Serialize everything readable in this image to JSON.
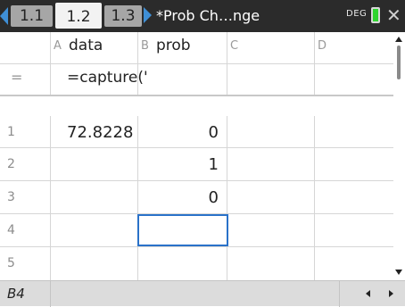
{
  "topbar": {
    "tabs": [
      {
        "label": "1.1",
        "active": false
      },
      {
        "label": "1.2",
        "active": true
      },
      {
        "label": "1.3",
        "active": false
      }
    ],
    "doc_title": "*Prob Ch…nge",
    "angle_mode": "DEG",
    "colors": {
      "accent": "#3f8fd6",
      "battery": "#2fd42f",
      "bar": "#2b2b2b"
    }
  },
  "columns": [
    {
      "letter": "A",
      "name": "data"
    },
    {
      "letter": "B",
      "name": "prob"
    },
    {
      "letter": "C",
      "name": ""
    },
    {
      "letter": "D",
      "name": ""
    }
  ],
  "formula_row": {
    "marker": "=",
    "A": "=capture('",
    "B": "",
    "C": "",
    "D": ""
  },
  "rows": [
    {
      "num": "1",
      "A": "72.8228",
      "B": "0",
      "C": "",
      "D": ""
    },
    {
      "num": "2",
      "A": "",
      "B": "1",
      "C": "",
      "D": ""
    },
    {
      "num": "3",
      "A": "",
      "B": "0",
      "C": "",
      "D": ""
    },
    {
      "num": "4",
      "A": "",
      "B": "",
      "C": "",
      "D": ""
    },
    {
      "num": "5",
      "A": "",
      "B": "",
      "C": "",
      "D": ""
    }
  ],
  "statusbar": {
    "cell_ref": "B4"
  },
  "selection": {
    "cell": "B4",
    "color": "#2a72c9"
  }
}
